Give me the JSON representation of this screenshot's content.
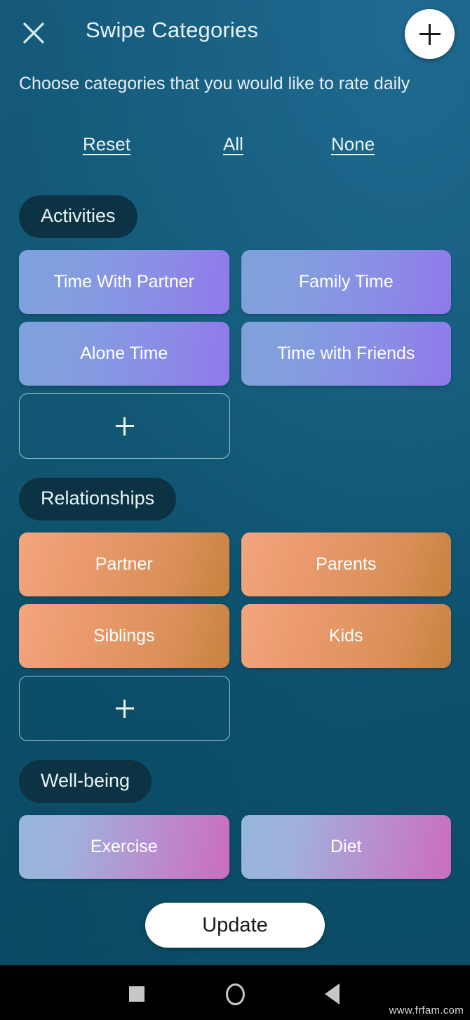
{
  "header": {
    "title": "Swipe Categories",
    "close_icon": "close-icon",
    "add_icon": "plus-icon"
  },
  "subtitle": "Choose categories that you would like to rate daily",
  "quick_links": [
    {
      "label": "Reset",
      "name": "reset-link"
    },
    {
      "label": "All",
      "name": "all-link"
    },
    {
      "label": "None",
      "name": "none-link"
    }
  ],
  "sections": [
    {
      "title": "Activities",
      "style": "blue-purple",
      "chips": [
        "Time With Partner",
        "Family Time",
        "Alone Time",
        "Time with Friends"
      ],
      "has_add_button": true,
      "add_label": "+"
    },
    {
      "title": "Relationships",
      "style": "orange",
      "chips": [
        "Partner",
        "Parents",
        "Siblings",
        "Kids"
      ],
      "has_add_button": true,
      "add_label": "+"
    },
    {
      "title": "Well-being",
      "style": "pink",
      "chips": [
        "Exercise",
        "Diet"
      ],
      "has_add_button": false,
      "add_label": "+"
    }
  ],
  "update_button": "Update",
  "navbar": {
    "recents": "square-recents-icon",
    "home": "circle-home-icon",
    "back": "triangle-back-icon"
  },
  "watermark": "www.frfam.com",
  "colors": {
    "background_top": "#15597a",
    "background_bottom": "#0c4c66",
    "pill": "#0c3344",
    "text": "#e9f3f6",
    "chip_blue_purple_start": "#7fa1da",
    "chip_blue_purple_end": "#9079ea",
    "chip_orange_start": "#f3a57c",
    "chip_orange_end": "#c8823f",
    "chip_pink_start": "#95b6da",
    "chip_pink_end": "#cb6dbd",
    "button_white": "#ffffff",
    "navbar": "#000000"
  }
}
